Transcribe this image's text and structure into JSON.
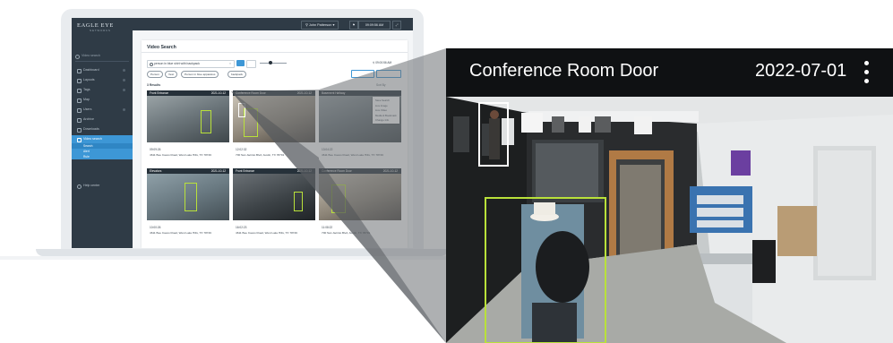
{
  "app": {
    "brand": "EAGLE EYE",
    "brand_sub": "NETWORKS",
    "user": "John Patterson",
    "clock": "09:09:56 AM"
  },
  "sidebar": {
    "search_placeholder": "Video search",
    "items": [
      {
        "label": "Dashboard"
      },
      {
        "label": "Layouts"
      },
      {
        "label": "Tags"
      },
      {
        "label": "Map"
      },
      {
        "label": "Users"
      },
      {
        "label": "Archive"
      },
      {
        "label": "Downloads"
      },
      {
        "label": "Video search"
      }
    ],
    "sub_items": [
      "Search",
      "Alert",
      "Rule"
    ],
    "help": "Help center"
  },
  "video_search": {
    "title": "Video Search",
    "query": "person in blue shirt with backpack",
    "chips": [
      "Person",
      "Vest",
      "Person in blue apparatus",
      "backpack"
    ],
    "results_label": "3 Results",
    "sort_label": "Sort By",
    "time_range": "09:00:56 AM",
    "menu": [
      "Save Search",
      "Live Image",
      "Live Video",
      "Media & Bookmark",
      "Change Info"
    ],
    "cards": [
      {
        "name": "Front Entrance",
        "date": "2021-10-12",
        "time": "09:09:26",
        "address": "4611 Bee Caves Road, West Lake Hills, TX 78746"
      },
      {
        "name": "Conference Room Door",
        "date": "2021-10-12",
        "time": "12:02:32",
        "address": "700 San Jacinto Blvd, Austin, TX 78701"
      },
      {
        "name": "Basement Hallway",
        "date": "",
        "time": "13:04:22",
        "address": "4611 Bee Caves Road, West Lake Hills, TX 78746"
      },
      {
        "name": "Elevators",
        "date": "2021-10-12",
        "time": "10:00:26",
        "address": "4611 Bee Caves Road, West Lake Hills, TX 78746"
      },
      {
        "name": "Front Entrance",
        "date": "2021-10-12",
        "time": "16:02:23",
        "address": "4611 Bee Caves Road, West Lake Hills, TX 78746"
      },
      {
        "name": "Conference Room Door",
        "date": "2021-10-12",
        "time": "11:08:22",
        "address": "700 San Jacinto Blvd, Austin, TX 78701"
      }
    ]
  },
  "zoom_card": {
    "title": "Conference Room Door",
    "date": "2022-07-01"
  },
  "colors": {
    "sidebar": "#2f3b46",
    "accent": "#3d97d6",
    "detection": "#b9e13a",
    "header": "#0f1113"
  }
}
